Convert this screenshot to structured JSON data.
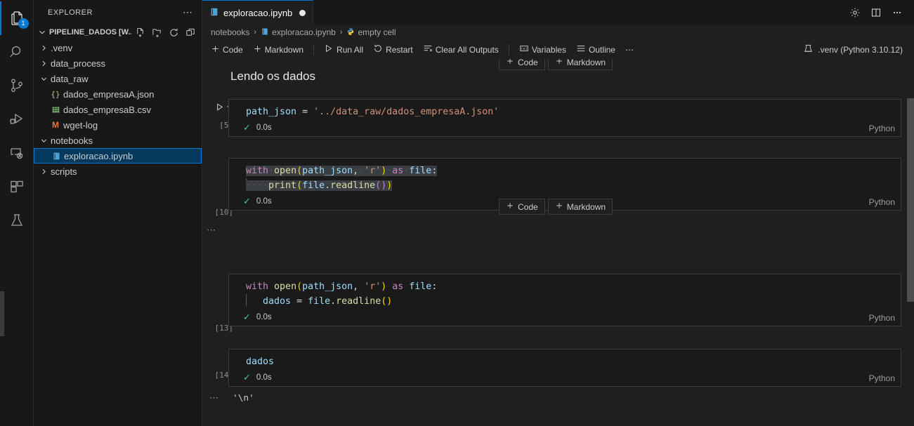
{
  "activity_bar": {
    "items": [
      {
        "name": "explorer",
        "icon": "files-icon",
        "badge": "1",
        "active": true
      },
      {
        "name": "search",
        "icon": "search-icon",
        "badge": "",
        "active": false
      },
      {
        "name": "source-control",
        "icon": "source-control-icon",
        "badge": "",
        "active": false
      },
      {
        "name": "run-and-debug",
        "icon": "run-debug-icon",
        "badge": "",
        "active": false
      },
      {
        "name": "remote-explorer",
        "icon": "remote-explorer-icon",
        "badge": "",
        "active": false
      },
      {
        "name": "extensions",
        "icon": "extensions-icon",
        "badge": "",
        "active": false
      },
      {
        "name": "testing",
        "icon": "beaker-icon",
        "badge": "",
        "active": false
      }
    ]
  },
  "sidebar": {
    "title": "EXPLORER",
    "more_label": "⋯",
    "project_name": "PIPELINE_DADOS [W...",
    "header_actions": [
      {
        "name": "new-file",
        "icon": "new-file-icon"
      },
      {
        "name": "new-folder",
        "icon": "new-folder-icon"
      },
      {
        "name": "refresh",
        "icon": "refresh-icon"
      },
      {
        "name": "collapse-all",
        "icon": "collapse-all-icon"
      }
    ],
    "tree": [
      {
        "label": ".venv",
        "type": "folder",
        "expanded": false,
        "indent": 1,
        "selected": false,
        "icon": ""
      },
      {
        "label": "data_process",
        "type": "folder",
        "expanded": false,
        "indent": 1,
        "selected": false,
        "icon": ""
      },
      {
        "label": "data_raw",
        "type": "folder",
        "expanded": true,
        "indent": 1,
        "selected": false,
        "icon": ""
      },
      {
        "label": "dados_empresaA.json",
        "type": "file",
        "expanded": false,
        "indent": 2,
        "selected": false,
        "icon": "json-icon"
      },
      {
        "label": "dados_empresaB.csv",
        "type": "file",
        "expanded": false,
        "indent": 2,
        "selected": false,
        "icon": "csv-icon"
      },
      {
        "label": "wget-log",
        "type": "file",
        "expanded": false,
        "indent": 2,
        "selected": false,
        "icon": "markdown-icon"
      },
      {
        "label": "notebooks",
        "type": "folder",
        "expanded": true,
        "indent": 1,
        "selected": false,
        "icon": ""
      },
      {
        "label": "exploracao.ipynb",
        "type": "file",
        "expanded": false,
        "indent": 2,
        "selected": true,
        "icon": "notebook-icon"
      },
      {
        "label": "scripts",
        "type": "folder",
        "expanded": false,
        "indent": 1,
        "selected": false,
        "icon": ""
      }
    ]
  },
  "tabbar": {
    "tabs": [
      {
        "label": "exploracao.ipynb",
        "icon": "notebook-icon",
        "dirty": true,
        "active": true
      }
    ],
    "actions": [
      {
        "name": "settings",
        "icon": "gear-icon"
      },
      {
        "name": "split-editor",
        "icon": "split-editor-icon"
      },
      {
        "name": "more-actions",
        "icon": "ellipsis-icon"
      }
    ]
  },
  "breadcrumb": {
    "items": [
      {
        "label": "notebooks",
        "icon": ""
      },
      {
        "label": "exploracao.ipynb",
        "icon": "notebook-icon"
      },
      {
        "label": "empty cell",
        "icon": "python-icon"
      }
    ],
    "separator": "›"
  },
  "notebook_toolbar": {
    "buttons": [
      {
        "label": "Code",
        "icon": "plus-icon"
      },
      {
        "label": "Markdown",
        "icon": "plus-icon"
      },
      {
        "label": "Run All",
        "icon": "play-icon"
      },
      {
        "label": "Restart",
        "icon": "restart-icon"
      },
      {
        "label": "Clear All Outputs",
        "icon": "clear-outputs-icon"
      },
      {
        "label": "Variables",
        "icon": "variables-icon"
      },
      {
        "label": "Outline",
        "icon": "outline-icon"
      },
      {
        "label": "⋯",
        "icon": "ellipsis-icon"
      }
    ],
    "kernel": {
      "label": ".venv (Python 3.10.12)",
      "icon": "kernel-icon"
    }
  },
  "add_cell": {
    "code_label": "Code",
    "markdown_label": "Markdown"
  },
  "notebook": {
    "markdown_cell": {
      "text": "Lendo os dados"
    },
    "language_label": "Python",
    "duration_label": "0.0s",
    "cells": [
      {
        "exec_count": "[5]",
        "status": "0.0s",
        "language": "Python",
        "code_plain": "path_json = '../data_raw/dados_empresaA.json'",
        "selected": false
      },
      {
        "exec_count": "[10]",
        "status": "0.0s",
        "language": "Python",
        "code_plain": "with open(path_json, 'r') as file:\n    print(file.readline())",
        "selected": true
      },
      {
        "exec_count": "[13]",
        "status": "0.0s",
        "language": "Python",
        "code_plain": "with open(path_json, 'r') as file:\n    dados = file.readline()",
        "selected": false
      },
      {
        "exec_count": "[14]",
        "status": "0.0s",
        "language": "Python",
        "code_plain": "dados",
        "selected": false
      }
    ],
    "outputs": [
      {
        "after_cell": 3,
        "text": "'\\n'"
      }
    ],
    "collapsed_marker": "⋯"
  },
  "colors": {
    "accent": "#0078d4",
    "editor_bg": "#1f1f1f",
    "sidebar_bg": "#181818",
    "cell_bg": "#1a1a1a",
    "selection": "#04395e",
    "success_green": "#50c878",
    "string": "#ce9178",
    "keyword": "#c586c0",
    "function": "#dcdcaa",
    "variable": "#9cdcfe"
  }
}
